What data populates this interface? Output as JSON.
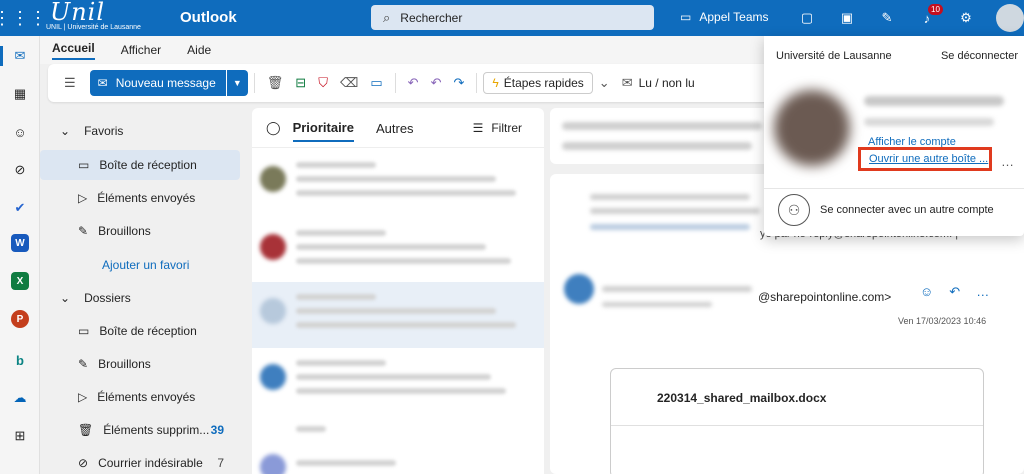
{
  "topbar": {
    "logo_text": "Unil",
    "logo_sub": "UNIL | Université de Lausanne",
    "app_name": "Outlook",
    "search_placeholder": "Rechercher",
    "teams_label": "Appel Teams",
    "notification_count": "10"
  },
  "ribbon": {
    "tabs": [
      "Accueil",
      "Afficher",
      "Aide"
    ],
    "new_message": "Nouveau message",
    "quick_steps": "Étapes rapides",
    "read_unread": "Lu / non lu"
  },
  "folders": {
    "favorites_label": "Favoris",
    "favorites": [
      {
        "label": "Boîte de réception"
      },
      {
        "label": "Éléments envoyés"
      },
      {
        "label": "Brouillons"
      }
    ],
    "add_favorite": "Ajouter un favori",
    "folders_label": "Dossiers",
    "items": [
      {
        "label": "Boîte de réception",
        "count": ""
      },
      {
        "label": "Brouillons",
        "count": ""
      },
      {
        "label": "Éléments envoyés",
        "count": ""
      },
      {
        "label": "Éléments supprim...",
        "count": "39"
      },
      {
        "label": "Courrier indésirable",
        "count": "7"
      }
    ]
  },
  "list": {
    "tab_focused": "Prioritaire",
    "tab_other": "Autres",
    "filter": "Filtrer"
  },
  "reading": {
    "sender_fragment": "ye par no-reply@sharepointonline.com. |",
    "sender_email_fragment": "@sharepointonline.com>",
    "date": "Ven 17/03/2023 10:46",
    "attachment_name": "220314_shared_mailbox.docx"
  },
  "account_popup": {
    "organization": "Université de Lausanne",
    "sign_out": "Se déconnecter",
    "view_account": "Afficher le compte",
    "open_other_mailbox": "Ouvrir une autre boîte ...",
    "sign_in_other": "Se connecter avec un autre compte"
  },
  "colors": {
    "brand": "#0f6cbd",
    "highlight_box": "#e03a1e"
  }
}
